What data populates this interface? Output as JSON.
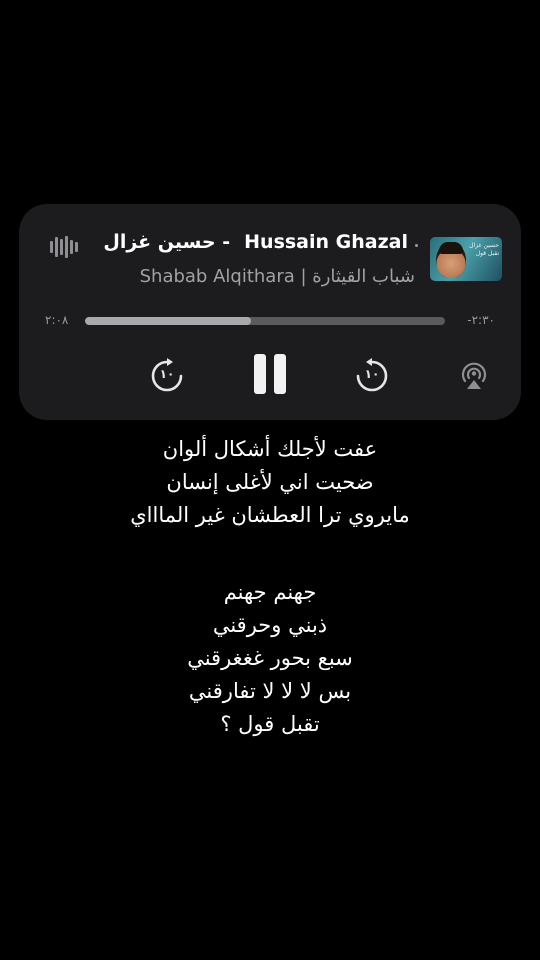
{
  "player": {
    "title": "Hussain Ghazal",
    "title_arabic": "حسين غزال -",
    "subtitle": "Shabab Alqithara | شباب القيثارة",
    "artwork": {
      "caption_line1": "حسين غزال",
      "caption_line2": "تقبل قول"
    },
    "time_elapsed": "٢:٠٨",
    "time_remaining": "-٢:٣٠",
    "progress": 0.46,
    "skip_back_label": "١٠",
    "skip_forward_label": "١٠",
    "colors": {
      "background": "#1c1c1e",
      "track": "#5a5a5e",
      "fill": "#a8a8ad"
    }
  },
  "lyrics": {
    "stanza1": [
      "عفت لأجلك أشكال ألوان",
      "ضحيت اني لأغلى إنسان",
      "مايروي ترا العطشان غير الماااي"
    ],
    "stanza2": [
      "جهنم جهنم",
      "ذبني وحرقني",
      "سبع بحور غغغرقني",
      "بس لا لا لا تفارقني",
      "تقبل قول ؟"
    ]
  },
  "icons": [
    "waveform-icon",
    "skip-back-10-icon",
    "pause-icon",
    "skip-forward-10-icon",
    "airplay-icon"
  ]
}
